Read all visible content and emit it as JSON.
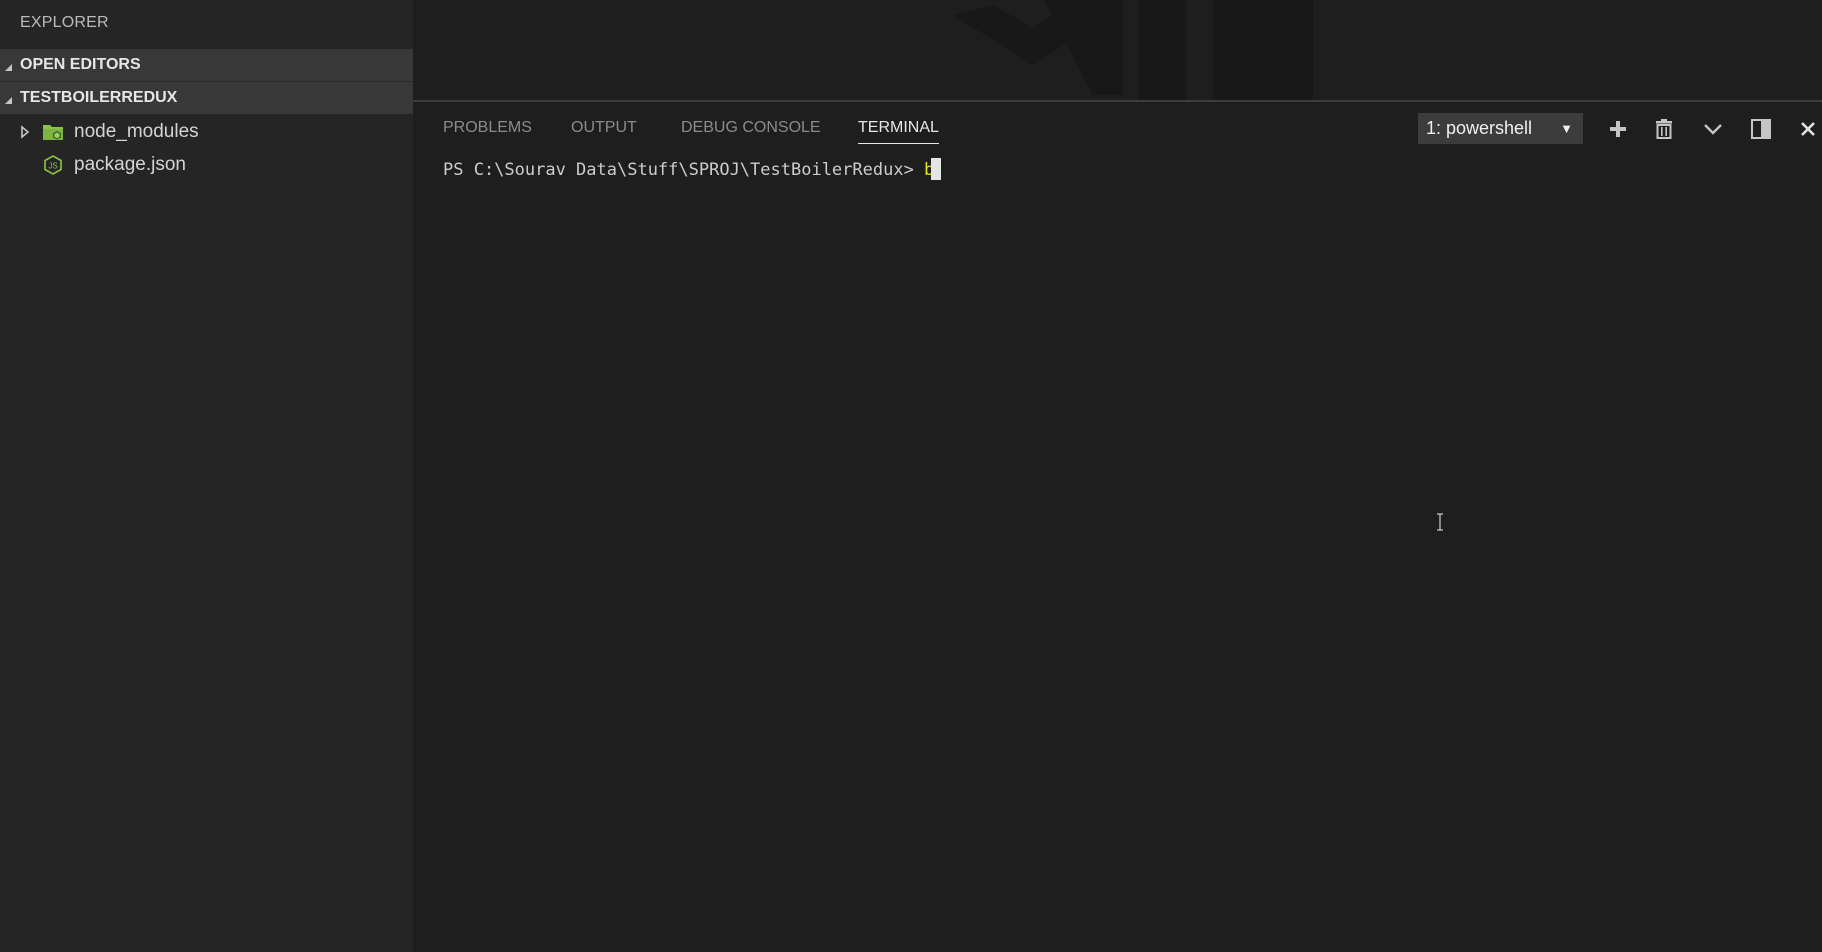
{
  "sidebar": {
    "title": "EXPLORER",
    "sections": [
      {
        "label": "OPEN EDITORS",
        "expanded": true
      },
      {
        "label": "TESTBOILERREDUX",
        "expanded": true
      }
    ],
    "tree": [
      {
        "label": "node_modules",
        "kind": "folder",
        "icon": "node-folder-icon",
        "collapsed": true
      },
      {
        "label": "package.json",
        "kind": "file",
        "icon": "nodejs-file-icon"
      }
    ]
  },
  "panel": {
    "tabs": [
      {
        "label": "PROBLEMS",
        "active": false
      },
      {
        "label": "OUTPUT",
        "active": false
      },
      {
        "label": "DEBUG CONSOLE",
        "active": false
      },
      {
        "label": "TERMINAL",
        "active": true
      }
    ],
    "terminal_select": {
      "value": "1: powershell"
    },
    "actions": [
      "plus-icon",
      "trash-icon",
      "chevron-down-icon",
      "split-panel-icon",
      "close-icon"
    ]
  },
  "terminal": {
    "prompt": "PS C:\\Sourav Data\\Stuff\\SPROJ\\TestBoilerRedux> ",
    "typed": "b"
  },
  "colors": {
    "sidebar_bg": "#252526",
    "section_header_bg": "#383838",
    "panel_bg": "#1e1e1e",
    "typed_text": "#e5e510",
    "node_icon_green": "#8bc34a"
  }
}
